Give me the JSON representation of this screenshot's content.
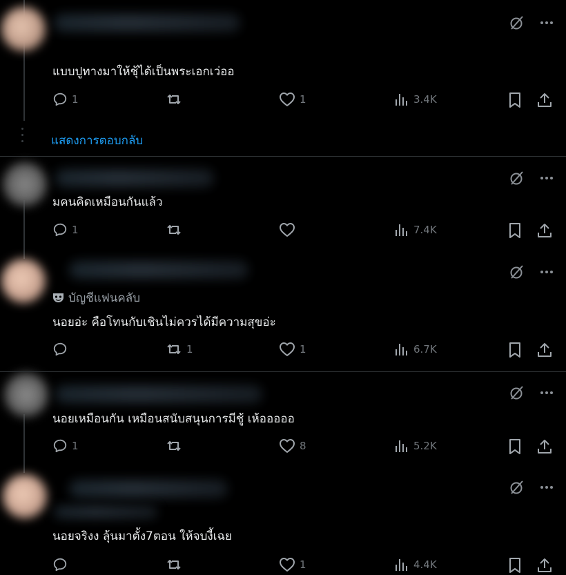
{
  "colors": {
    "background": "#000000",
    "text": "#e7e9ea",
    "muted": "#71767b",
    "link": "#1d9bf0",
    "divider": "#2f3336"
  },
  "icons": {
    "grok": "slashed-circle-icon",
    "more": "more-dots-icon",
    "reply": "reply-bubble-icon",
    "repost": "repost-icon",
    "like": "heart-icon",
    "views": "views-bars-icon",
    "bookmark": "bookmark-icon",
    "share": "share-upload-icon"
  },
  "show_replies": "แสดงการตอบกลับ",
  "posts": [
    {
      "handle": "",
      "text": "แบบปูทางมาให้ชุ้ได้เป็นพระเอกเว่ออ",
      "replies": "1",
      "reposts": "",
      "likes": "1",
      "views": "3.4K"
    },
    {
      "handle": "",
      "text": "มคนคิดเหมือนกันแล้ว",
      "replies": "1",
      "reposts": "",
      "likes": "",
      "views": "7.4K"
    },
    {
      "handle": "บัญชีแฟนคลับ",
      "text": "นอยอ่ะ คือโทนกับเชินไม่ควรได้มีความสุขอ่ะ",
      "replies": "",
      "reposts": "1",
      "likes": "1",
      "views": "6.7K"
    },
    {
      "handle": "",
      "text": "นอยเหมือนกัน เหมือนสนับสนุนการมีชู้ เห้อออออ",
      "replies": "1",
      "reposts": "",
      "likes": "8",
      "views": "5.2K"
    },
    {
      "handle": "",
      "text": "นอยจริงง ลุ้นมาตั้ง7ตอน ให้จบงี้เฉย",
      "replies": "",
      "reposts": "",
      "likes": "1",
      "views": "4.4K"
    }
  ]
}
